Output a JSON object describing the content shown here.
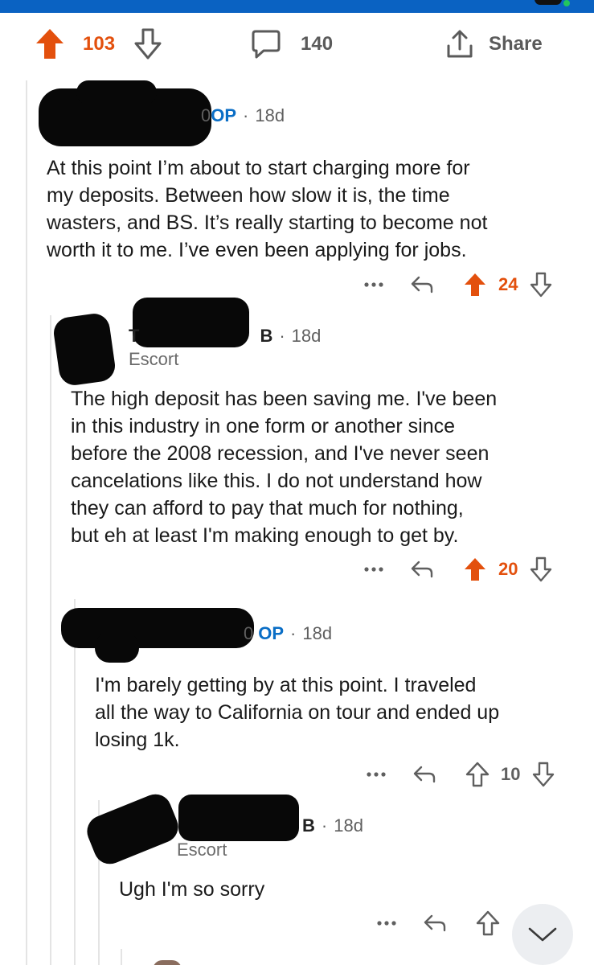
{
  "post_actions": {
    "upvotes": "103",
    "comments": "140",
    "share_label": "Share",
    "upvote_color": "#e3500d"
  },
  "comments": [
    {
      "author_tail": "0",
      "badge": "OP",
      "age": "18d",
      "body_lines": [
        "At this point I’m about to start charging more for",
        "my deposits. Between how slow it is, the time",
        "wasters, and BS. It’s really starting to become not",
        "worth it to me. I’ve even been applying for jobs."
      ],
      "votes": "24",
      "upvoted": true
    },
    {
      "author_head": "T",
      "author_tail": "B",
      "age": "18d",
      "flair": "Escort",
      "body_lines": [
        "The high deposit has been saving me. I've been",
        "in this industry in one form or another since",
        "before the 2008 recession, and I've never seen",
        "cancelations like this. I do not understand how",
        "they can afford to pay that much for nothing,",
        "but eh at least I'm making enough to get by."
      ],
      "votes": "20",
      "upvoted": true
    },
    {
      "author_tail": "0",
      "badge": "OP",
      "age": "18d",
      "body_lines": [
        "I'm barely getting by at this point. I traveled",
        "all the way to California on tour and ended up",
        "losing 1k."
      ],
      "votes": "10",
      "upvoted": false
    },
    {
      "author_tail": "B",
      "age": "18d",
      "flair": "Escort",
      "body_lines": [
        "Ugh I'm so sorry"
      ],
      "votes": "",
      "upvoted": false
    }
  ],
  "icons": {
    "upvote": "arrow-up-icon",
    "downvote": "arrow-down-icon",
    "comment": "speech-bubble-icon",
    "share": "share-icon",
    "reply": "reply-arrow-icon",
    "more": "more-dots-icon",
    "collapse": "chevron-down-icon"
  },
  "colors": {
    "op_badge": "#0a6ec6",
    "upvoted": "#e3500d",
    "meta": "#5f5f5f"
  }
}
